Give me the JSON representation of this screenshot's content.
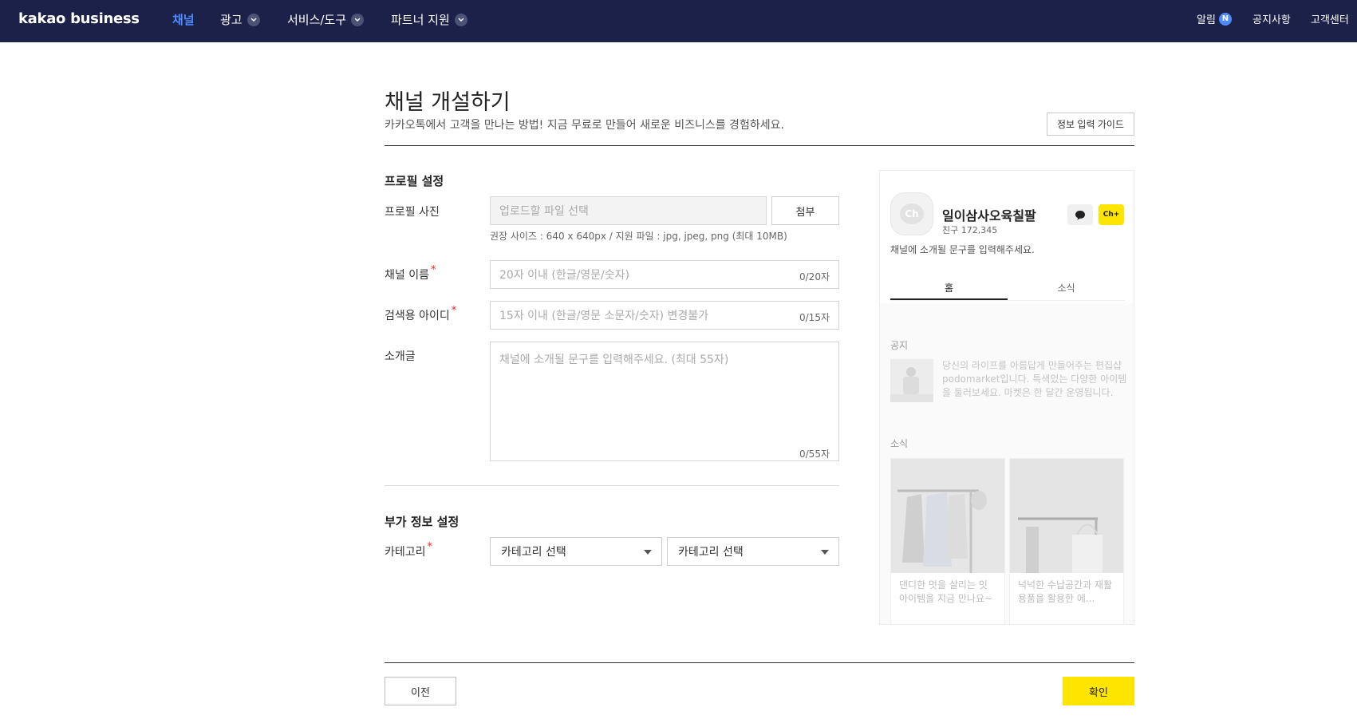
{
  "header": {
    "logo": "kakao business",
    "nav": [
      {
        "label": "채널",
        "active": true
      },
      {
        "label": "광고"
      },
      {
        "label": "서비스/도구"
      },
      {
        "label": "파트너 지원"
      }
    ],
    "right": {
      "alerts": "알림",
      "alerts_badge": "N",
      "notice": "공지사항",
      "support": "고객센터"
    }
  },
  "page": {
    "title": "채널 개설하기",
    "subtitle": "카카오톡에서 고객을 만나는 방법! 지금 무료로 만들어 새로운 비즈니스를 경험하세요.",
    "guide_button": "정보 입력 가이드"
  },
  "profile": {
    "section_title": "프로필 설정",
    "photo_label": "프로필 사진",
    "photo_placeholder": "업로드할 파일 선택",
    "attach_button": "첨부",
    "photo_hint": "권장 사이즈 : 640 x 640px / 지원 파일 : jpg, jpeg, png (최대 10MB)",
    "name_label": "채널 이름",
    "name_placeholder": "20자 이내 (한글/영문/숫자)",
    "name_counter": "0/20자",
    "search_id_label": "검색용 아이디",
    "search_id_placeholder": "15자 이내 (한글/영문 소문자/숫자) 변경불가",
    "search_id_counter": "0/15자",
    "intro_label": "소개글",
    "intro_placeholder": "채널에 소개될 문구를 입력해주세요. (최대 55자)",
    "intro_counter": "0/55자",
    "required_mark": "*"
  },
  "extra": {
    "section_title": "부가 정보 설정",
    "category_label": "카테고리",
    "category_select_1": "카테고리 선택",
    "category_select_2": "카테고리 선택"
  },
  "preview": {
    "avatar_text": "Ch",
    "channel_name": "일이삼사오육칠팔",
    "friends": "친구 172,345",
    "add_label": "Ch+",
    "intro": "채널에 소개될 문구를 입력해주세요.",
    "tabs": [
      "홈",
      "소식"
    ],
    "notice_title": "공지",
    "notice_text": "당신의 라이프를 아름답게 만들어주는 편집샵 podomarket입니다. 특색있는 다양한 아이템을 둘러보세요. 마켓은 한 달간 운영됩니다.",
    "news_title": "소식",
    "cards": [
      {
        "caption": "댄디한 멋을 살리는 잇 아이템을 지금 만나요~"
      },
      {
        "caption": "넉넉한 수납공간과 재활용품을 활용한 에..."
      }
    ]
  },
  "footer": {
    "prev_button": "이전",
    "confirm_button": "확인"
  },
  "colors": {
    "header_bg": "#1b2148",
    "nav_active": "#4f8bff",
    "confirm_bg": "#fee500",
    "required": "#e22222"
  }
}
